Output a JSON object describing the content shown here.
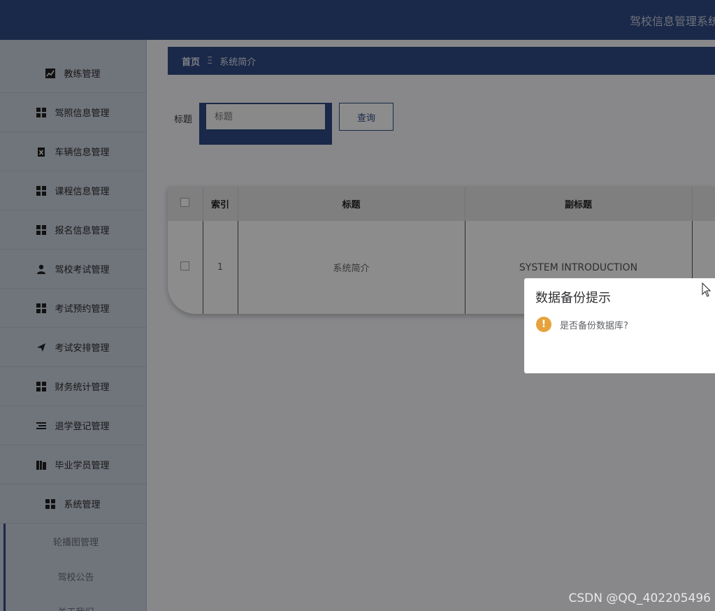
{
  "header": {
    "app_title": "驾校信息管理系统"
  },
  "sidebar": {
    "items": [
      {
        "label": "教练管理",
        "icon": "chart-icon"
      },
      {
        "label": "驾照信息管理",
        "icon": "grid-icon"
      },
      {
        "label": "车辆信息管理",
        "icon": "clipboard-icon"
      },
      {
        "label": "课程信息管理",
        "icon": "grid-icon"
      },
      {
        "label": "报名信息管理",
        "icon": "grid-icon"
      },
      {
        "label": "驾校考试管理",
        "icon": "user-icon"
      },
      {
        "label": "考试预约管理",
        "icon": "grid-icon"
      },
      {
        "label": "考试安排管理",
        "icon": "send-icon"
      },
      {
        "label": "财务统计管理",
        "icon": "grid-icon"
      },
      {
        "label": "退学登记管理",
        "icon": "list-icon"
      },
      {
        "label": "毕业学员管理",
        "icon": "book-icon"
      },
      {
        "label": "系统管理",
        "icon": "grid-icon"
      }
    ],
    "subitems": [
      "轮播图管理",
      "驾校公告",
      "关于我们"
    ]
  },
  "breadcrumb": {
    "home": "首页",
    "separator": "Ξ",
    "current": "系统简介"
  },
  "search": {
    "label": "标题",
    "placeholder": "标题",
    "button": "查询"
  },
  "table": {
    "headers": [
      "",
      "索引",
      "标题",
      "副标题"
    ],
    "rows": [
      {
        "index": "1",
        "title": "系统简介",
        "subtitle": "SYSTEM INTRODUCTION"
      }
    ]
  },
  "dialog": {
    "title": "数据备份提示",
    "message": "是否备份数据库?",
    "icon": "warning-icon"
  },
  "watermark": "CSDN @QQ_402205496",
  "colors": {
    "primary": "#304a86",
    "warning": "#e6a23c"
  }
}
